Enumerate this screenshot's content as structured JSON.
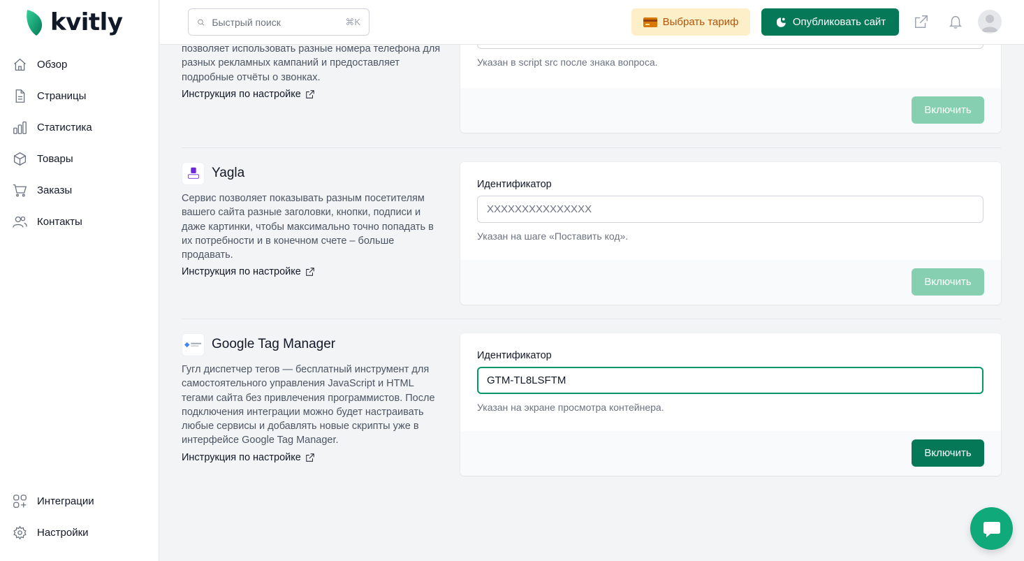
{
  "brand": {
    "name": "kvitly"
  },
  "sidebar": {
    "items": [
      {
        "label": "Обзор",
        "icon": "home-icon"
      },
      {
        "label": "Страницы",
        "icon": "document-icon"
      },
      {
        "label": "Статистика",
        "icon": "chart-icon"
      },
      {
        "label": "Товары",
        "icon": "cube-icon"
      },
      {
        "label": "Заказы",
        "icon": "cart-icon"
      },
      {
        "label": "Контакты",
        "icon": "users-icon"
      }
    ],
    "bottom": [
      {
        "label": "Интеграции",
        "icon": "grid-plus-icon"
      },
      {
        "label": "Настройки",
        "icon": "gear-icon"
      }
    ]
  },
  "topbar": {
    "search_placeholder": "Быстрый поиск",
    "search_shortcut": "⌘K",
    "tariff_label": "Выбрать тариф",
    "publish_label": "Опубликовать сайт"
  },
  "colors": {
    "accent": "#047857",
    "accent_disabled": "#86cfb0",
    "tariff_bg": "#fdf0c8",
    "tariff_text": "#b45309"
  },
  "integrations": [
    {
      "desc_partial": "позволяет использовать разные номера телефона для разных рекламных кампаний и предоставляет подробные отчёты о звонках.",
      "instruction": "Инструкция по настройке",
      "help": "Указан в script src после знака вопроса.",
      "button": "Включить"
    },
    {
      "title": "Yagla",
      "logo_text": "YAGLA",
      "desc": "Сервис позволяет показывать разным посетителям вашего сайта разные заголовки, кнопки, подписи и даже картинки, чтобы максимально точно попадать в их потребности и в конечном счете – больше продавать.",
      "instruction": "Инструкция по настройке",
      "field_label": "Идентификатор",
      "placeholder": "XXXXXXXXXXXXXXX",
      "help": "Указан на шаге «Поставить код».",
      "button": "Включить"
    },
    {
      "title": "Google Tag Manager",
      "logo_text": "Google Tag Manager",
      "desc": "Гугл диспетчер тегов — бесплатный инструмент для самостоятельного управления JavaScript и HTML тегами сайта без привлечения программистов. После подключения интеграции можно будет настраивать любые сервисы и добавлять новые скрипты уже в интерфейсе Google Tag Manager.",
      "instruction": "Инструкция по настройке",
      "field_label": "Идентификатор",
      "value": "GTM-TL8LSFTM",
      "help": "Указан на экране просмотра контейнера.",
      "button": "Включить"
    }
  ]
}
